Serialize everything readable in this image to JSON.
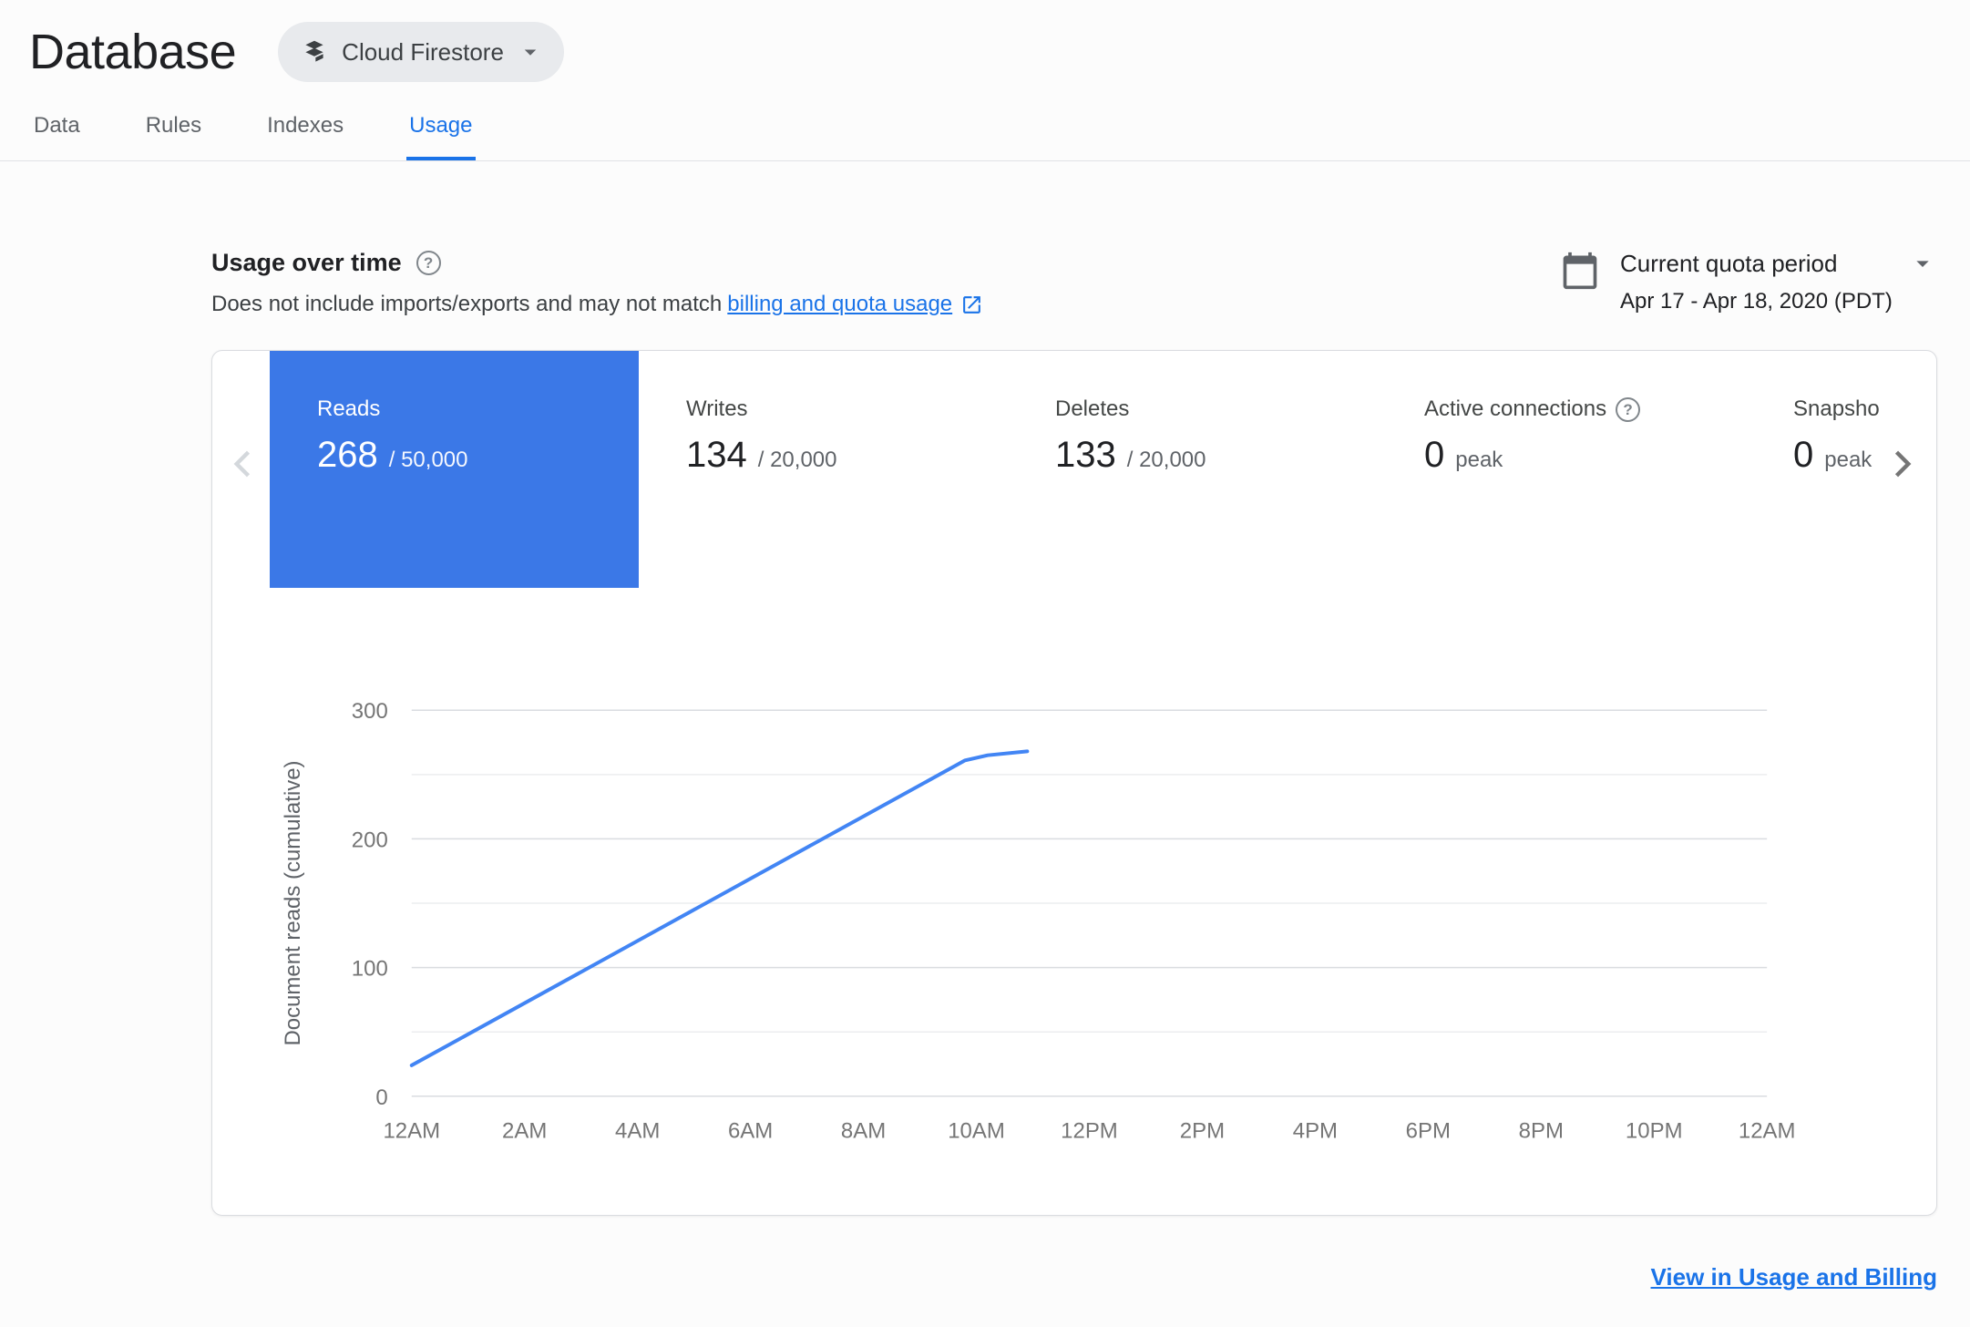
{
  "header": {
    "title": "Database",
    "product_selector": {
      "label": "Cloud Firestore"
    }
  },
  "tabs": {
    "items": [
      {
        "label": "Data",
        "active": false
      },
      {
        "label": "Rules",
        "active": false
      },
      {
        "label": "Indexes",
        "active": false
      },
      {
        "label": "Usage",
        "active": true
      }
    ]
  },
  "usage_header": {
    "title": "Usage over time",
    "description_prefix": "Does not include imports/exports and may not match",
    "link_text": "billing and quota usage",
    "quota": {
      "label": "Current quota period",
      "date_range": "Apr 17 - Apr 18, 2020 (PDT)"
    }
  },
  "metrics": {
    "tiles": [
      {
        "label": "Reads",
        "value": "268",
        "suffix": "/ 50,000",
        "selected": true,
        "has_help": false
      },
      {
        "label": "Writes",
        "value": "134",
        "suffix": "/ 20,000",
        "selected": false,
        "has_help": false
      },
      {
        "label": "Deletes",
        "value": "133",
        "suffix": "/ 20,000",
        "selected": false,
        "has_help": false
      },
      {
        "label": "Active connections",
        "value": "0",
        "suffix": "peak",
        "selected": false,
        "has_help": true
      },
      {
        "label": "Snapsho",
        "value": "0",
        "suffix": "peak",
        "selected": false,
        "has_help": false
      }
    ]
  },
  "chart_data": {
    "type": "line",
    "title": "",
    "xlabel": "",
    "ylabel": "Document reads (cumulative)",
    "ylim": [
      0,
      300
    ],
    "xlim_hours": [
      0,
      24
    ],
    "y_ticks": [
      0,
      100,
      200,
      300
    ],
    "grid_step": 50,
    "grid": true,
    "legend_position": "none",
    "x_tick_hours": [
      0,
      2,
      4,
      6,
      8,
      10,
      12,
      14,
      16,
      18,
      20,
      22,
      24
    ],
    "x_tick_labels": [
      "12AM",
      "2AM",
      "4AM",
      "6AM",
      "8AM",
      "10AM",
      "12PM",
      "2PM",
      "4PM",
      "6PM",
      "8PM",
      "10PM",
      "12AM"
    ],
    "series": [
      {
        "name": "Document reads (cumulative)",
        "color": "#4285f4",
        "points": [
          [
            0,
            24
          ],
          [
            9.8,
            261
          ],
          [
            10.2,
            265
          ],
          [
            10.9,
            268
          ]
        ]
      }
    ]
  },
  "footer": {
    "link_text": "View in Usage and Billing"
  },
  "icons": {
    "help_glyph": "?"
  },
  "colors": {
    "accent": "#1a73e8",
    "selected_tile": "#3b78e7",
    "line_color": "#4285f4"
  }
}
